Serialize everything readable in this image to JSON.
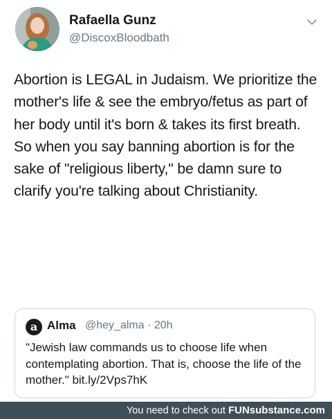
{
  "tweet": {
    "display_name": "Rafaella Gunz",
    "handle": "@DiscoxBloodbath",
    "text": "Abortion is LEGAL in Judaism. We prioritize the mother's life & see the embryo/fetus as part of her body until it's born & takes its first breath. So when you say banning abortion is for the sake of \"religious liberty,\" be damn sure to clarify you're talking about Christianity.",
    "menu_icon": "chevron-down-icon",
    "avatar_icon": "profile-photo"
  },
  "quote": {
    "logo_letter": "a",
    "name": "Alma",
    "meta": "@hey_alma · 20h",
    "text": "\"Jewish law commands us to choose life when contemplating abortion. That is, choose the life of the mother.\" bit.ly/2Vps7hK"
  },
  "footer": {
    "prefix": "You need to check out ",
    "brand": "FUNsubstance.com"
  },
  "colors": {
    "text": "#14171a",
    "secondary": "#657786",
    "border": "#ccd6dd",
    "footer_bg": "#3f4f58"
  }
}
